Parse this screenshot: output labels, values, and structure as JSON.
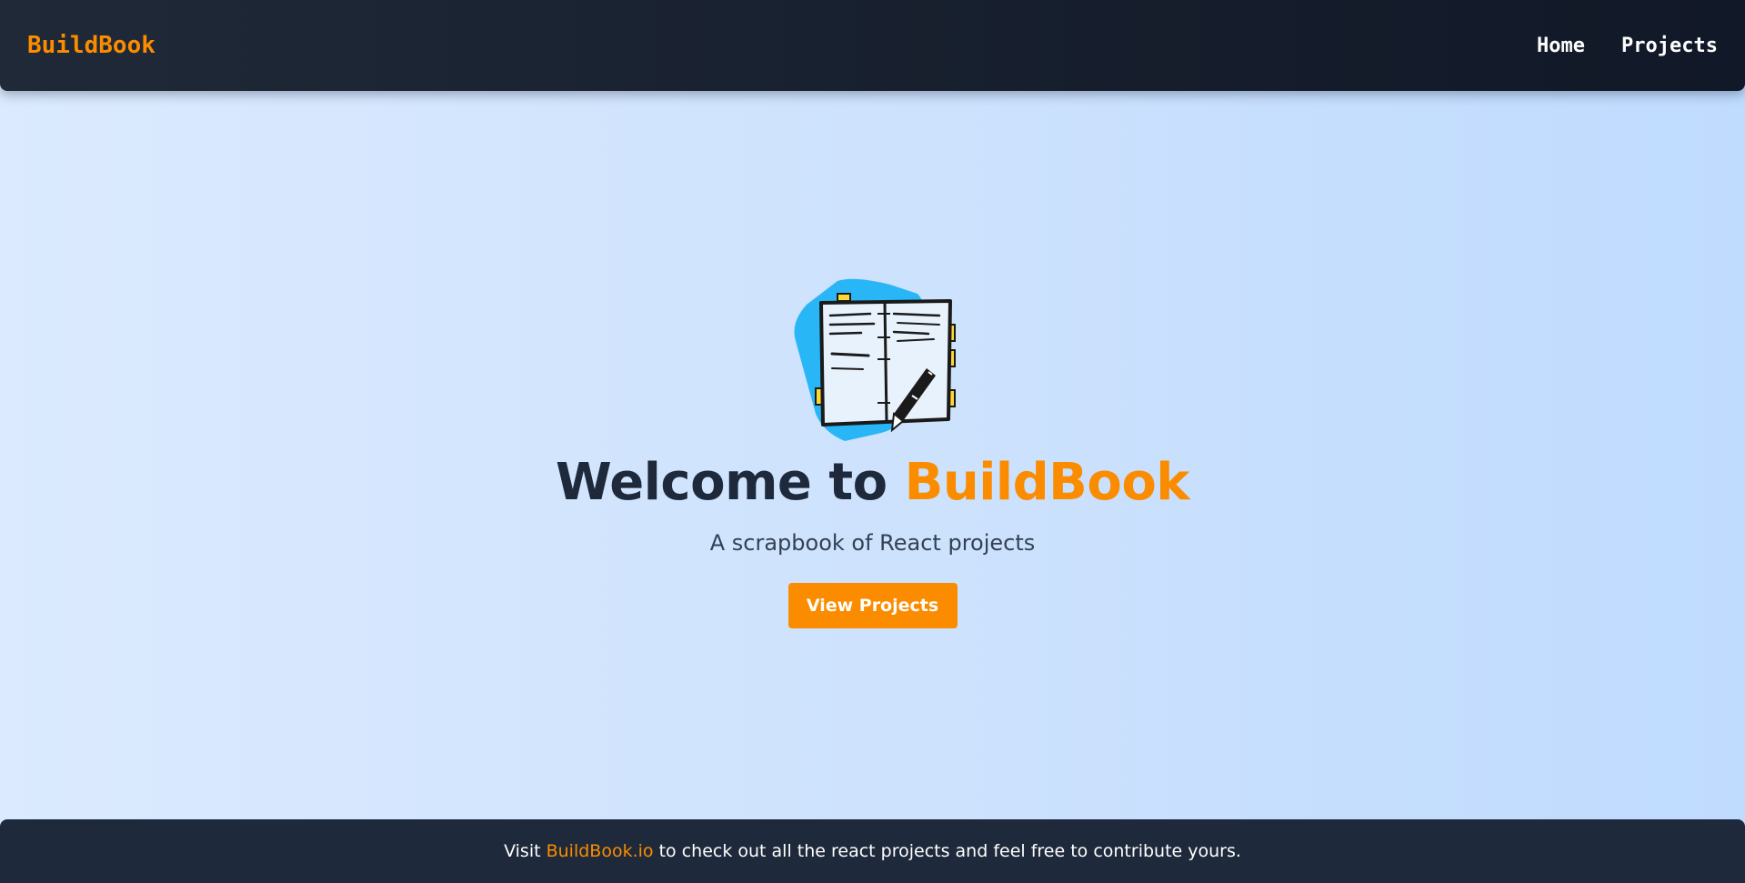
{
  "navbar": {
    "brand": "BuildBook",
    "links": [
      {
        "label": "Home"
      },
      {
        "label": "Projects"
      }
    ]
  },
  "hero": {
    "logo_icon": "scrapbook-notebook-icon",
    "title_prefix": "Welcome to ",
    "title_accent": "BuildBook",
    "subtitle": "A scrapbook of React projects",
    "cta_label": "View Projects"
  },
  "footer": {
    "text_before": "Visit ",
    "link_text": "BuildBook.io",
    "text_after": " to check out all the react projects and feel free to contribute yours."
  },
  "colors": {
    "accent": "#fb8c00",
    "navbar": "#1f2937",
    "footer": "#1e293b",
    "background": "#dbeafe",
    "title": "#1e293b",
    "logo_blob": "#29b6f6",
    "logo_tabs": "#fdd835"
  }
}
